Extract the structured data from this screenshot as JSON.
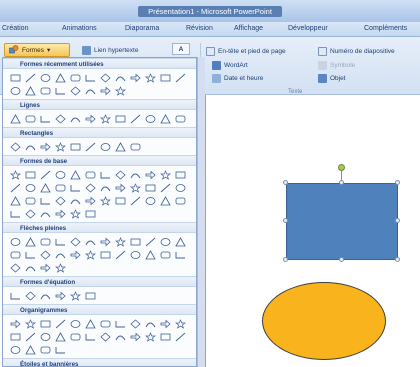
{
  "window": {
    "title": "Présentation1 - Microsoft PowerPoint"
  },
  "tabs": [
    "Création",
    "Animations",
    "Diaporama",
    "Révision",
    "Affichage",
    "Développeur",
    "Compléments"
  ],
  "ribbon": {
    "shapes_label": "Formes",
    "hyperlink_label": "Lien hypertexte",
    "textbox_label": "A",
    "header_footer_label": "En-tête et pied de page",
    "slide_number_label": "Numéro de diapositive",
    "wordart_label": "WordArt",
    "symbol_label": "Symbole",
    "datetime_label": "Date et heure",
    "object_label": "Objet",
    "group_text_label": "Texte"
  },
  "shape_categories": [
    {
      "name": "Formes récemment utilisées",
      "icons": [
        "textbox",
        "line",
        "arrow-line",
        "rectangle",
        "oval",
        "rounded-rect",
        "triangle",
        "l-shape",
        "connector",
        "bent-connector",
        "rounded-arrow",
        "callout",
        "brace-left",
        "brace-right",
        "star",
        "star5",
        "curve-left",
        "curve-right",
        "bracket",
        "bracket-right"
      ]
    },
    {
      "name": "Lignes",
      "icons": [
        "line",
        "arrow",
        "double-arrow",
        "elbow",
        "elbow-arrow",
        "elbow-double",
        "curved",
        "curved-arrow",
        "curved-double",
        "curve",
        "freeform",
        "scribble"
      ]
    },
    {
      "name": "Rectangles",
      "icons": [
        "rectangle",
        "rounded-rect",
        "snip1",
        "snip2",
        "snip-diag",
        "snip-round",
        "round1",
        "round2",
        "round-diag"
      ]
    },
    {
      "name": "Formes de base",
      "icons": [
        "textbox",
        "oval",
        "triangle",
        "right-triangle",
        "parallelogram",
        "trapezoid",
        "diamond",
        "pentagon",
        "hexagon",
        "heptagon",
        "octagon",
        "decagon",
        "dodecagon",
        "pie",
        "chord",
        "teardrop",
        "frame",
        "half-frame",
        "corner",
        "diag-stripe",
        "plus",
        "plaque",
        "can",
        "cube",
        "bevel",
        "donut",
        "no-symbol",
        "block-arc",
        "folded",
        "smiley",
        "heart",
        "lightning",
        "sun",
        "moon",
        "cloud",
        "arc",
        "bracket-pair",
        "brace-pair",
        "bracket-left",
        "bracket-right",
        "brace-left",
        "brace-right"
      ]
    },
    {
      "name": "Flèches pleines",
      "icons": [
        "arrow-right",
        "arrow-left",
        "arrow-up",
        "arrow-down",
        "arrow-lr",
        "arrow-ud",
        "quad-arrow",
        "lr-up",
        "bent",
        "u-turn",
        "left-up",
        "bent-up",
        "curved-right",
        "curved-left",
        "curved-up",
        "curved-down",
        "striped",
        "notched",
        "pentagon-arrow",
        "chevron",
        "callout-right",
        "callout-left",
        "callout-up",
        "callout-down",
        "callout-lr",
        "callout-ud",
        "callout-quad",
        "circular"
      ]
    },
    {
      "name": "Formes d'équation",
      "icons": [
        "plus",
        "minus",
        "multiply",
        "divide",
        "equal",
        "not-equal"
      ]
    },
    {
      "name": "Organigrammes",
      "icons": [
        "process",
        "alt-process",
        "decision",
        "data",
        "predefined",
        "internal",
        "document",
        "multidoc",
        "terminator",
        "preparation",
        "manual-input",
        "manual-op",
        "connector",
        "offpage",
        "card",
        "punched",
        "summing",
        "or",
        "collate",
        "sort",
        "extract",
        "merge",
        "stored",
        "delay",
        "seq-access",
        "magnetic",
        "direct",
        "display"
      ]
    },
    {
      "name": "Étoiles et bannières",
      "icons": []
    }
  ],
  "colors": {
    "rectangle_fill": "#4f81bd",
    "ellipse_fill": "#f9b31c",
    "accent": "#1e3f74"
  }
}
